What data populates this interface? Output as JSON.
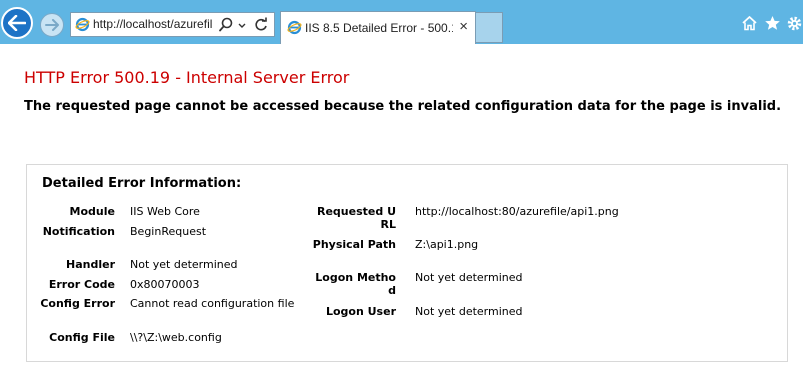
{
  "browser": {
    "address_url": "http://localhost/azurefil",
    "tab_title": "IIS 8.5 Detailed Error - 500.1...",
    "tab_close": "×",
    "icons": {
      "back": "back-arrow-icon",
      "forward": "forward-arrow-icon",
      "site": "ie-logo-icon",
      "search": "search-icon",
      "dropdown": "chevron-down-icon",
      "refresh": "refresh-icon",
      "home": "home-icon",
      "favorites": "star-icon",
      "tools": "gear-icon"
    },
    "colors": {
      "chrome": "#5fb5e3",
      "back_button": "#1d73c6"
    }
  },
  "page": {
    "title": "HTTP Error 500.19 - Internal Server Error",
    "subtitle": "The requested page cannot be accessed because the related configuration data for the page is invalid.",
    "title_color": "#cc0000"
  },
  "details": {
    "heading": "Detailed Error Information:",
    "left": [
      {
        "label": "Module",
        "value": "IIS Web Core"
      },
      {
        "label": "Notification",
        "value": "BeginRequest"
      },
      {
        "label": "Handler",
        "value": "Not yet determined"
      },
      {
        "label": "Error Code",
        "value": "0x80070003"
      },
      {
        "label": "Config Error",
        "value": "Cannot read configuration file"
      },
      {
        "label": "Config File",
        "value": "\\\\?\\Z:\\web.config"
      }
    ],
    "right": [
      {
        "label": "Requested URL",
        "value": "http://localhost:80/azurefile/api1.png"
      },
      {
        "label": "Physical Path",
        "value": "Z:\\api1.png"
      },
      {
        "label": "Logon Method",
        "value": "Not yet determined"
      },
      {
        "label": "Logon User",
        "value": "Not yet determined"
      }
    ]
  }
}
